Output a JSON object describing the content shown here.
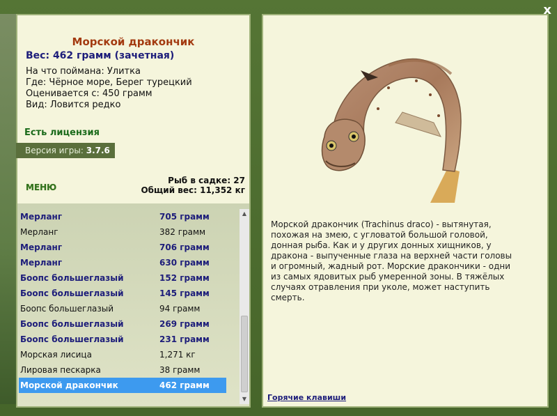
{
  "window": {
    "close_label": "x"
  },
  "fish": {
    "title": "Морской дракончик",
    "weight_line": "Вес: 462 грамм (зачетная)",
    "caught_on": "На что поймана: Улитка",
    "location": "Где: Чёрное море, Берег турецкий",
    "valued_from": "Оцениваетcя с: 450 грамм",
    "kind": "Вид: Ловится редко"
  },
  "license": "Есть лицензия",
  "version": {
    "label": "Версия игры:",
    "number": "3.7.6"
  },
  "menu_label": "МЕНЮ",
  "stats": {
    "fish_in_net": "Рыб в садке: 27",
    "total_weight": "Общий вес: 11,352 кг"
  },
  "catch_list": [
    {
      "name": "Мерланг",
      "weight": "705 грамм",
      "style": "bold"
    },
    {
      "name": "Мерланг",
      "weight": "382 грамм",
      "style": "normal"
    },
    {
      "name": "Мерланг",
      "weight": "706 грамм",
      "style": "bold"
    },
    {
      "name": "Мерланг",
      "weight": "630 грамм",
      "style": "bold"
    },
    {
      "name": "Боопс большеглазый",
      "weight": "152 грамм",
      "style": "bold"
    },
    {
      "name": "Боопс большеглазый",
      "weight": "145 грамм",
      "style": "bold"
    },
    {
      "name": "Боопс большеглазый",
      "weight": "94 грамм",
      "style": "normal"
    },
    {
      "name": "Боопс большеглазый",
      "weight": "269 грамм",
      "style": "bold"
    },
    {
      "name": "Боопс большеглазый",
      "weight": "231 грамм",
      "style": "bold"
    },
    {
      "name": "Морская лисица",
      "weight": "1,271 кг",
      "style": "normal"
    },
    {
      "name": "Лировая пескарка",
      "weight": "38 грамм",
      "style": "normal"
    },
    {
      "name": "Морской дракончик",
      "weight": "462 грамм",
      "style": "selected"
    }
  ],
  "description": "Морской дракончик (Trachinus draco) - вытянутая, похожая на змею, с угловатой большой головой, донная рыба. Как и у других донных хищников, у дракона - выпученные глаза на верхней части головы и огромный, жадный рот. Морские дракончики - одни из самых ядовитых рыб умеренной зоны. В тяжёлых случаях отравления при уколе, может наступить смерть.",
  "hotkeys_label": "Горячие клавиши",
  "icons": {
    "close": "close-icon",
    "scroll_up": "scroll-up-arrow-icon",
    "scroll_down": "scroll-down-arrow-icon"
  },
  "colors": {
    "frame": "#4c6a2d",
    "panel": "#f5f5dc",
    "title": "#a33a10",
    "accent_blue": "#1d1d7a",
    "selection": "#3d9aef"
  }
}
